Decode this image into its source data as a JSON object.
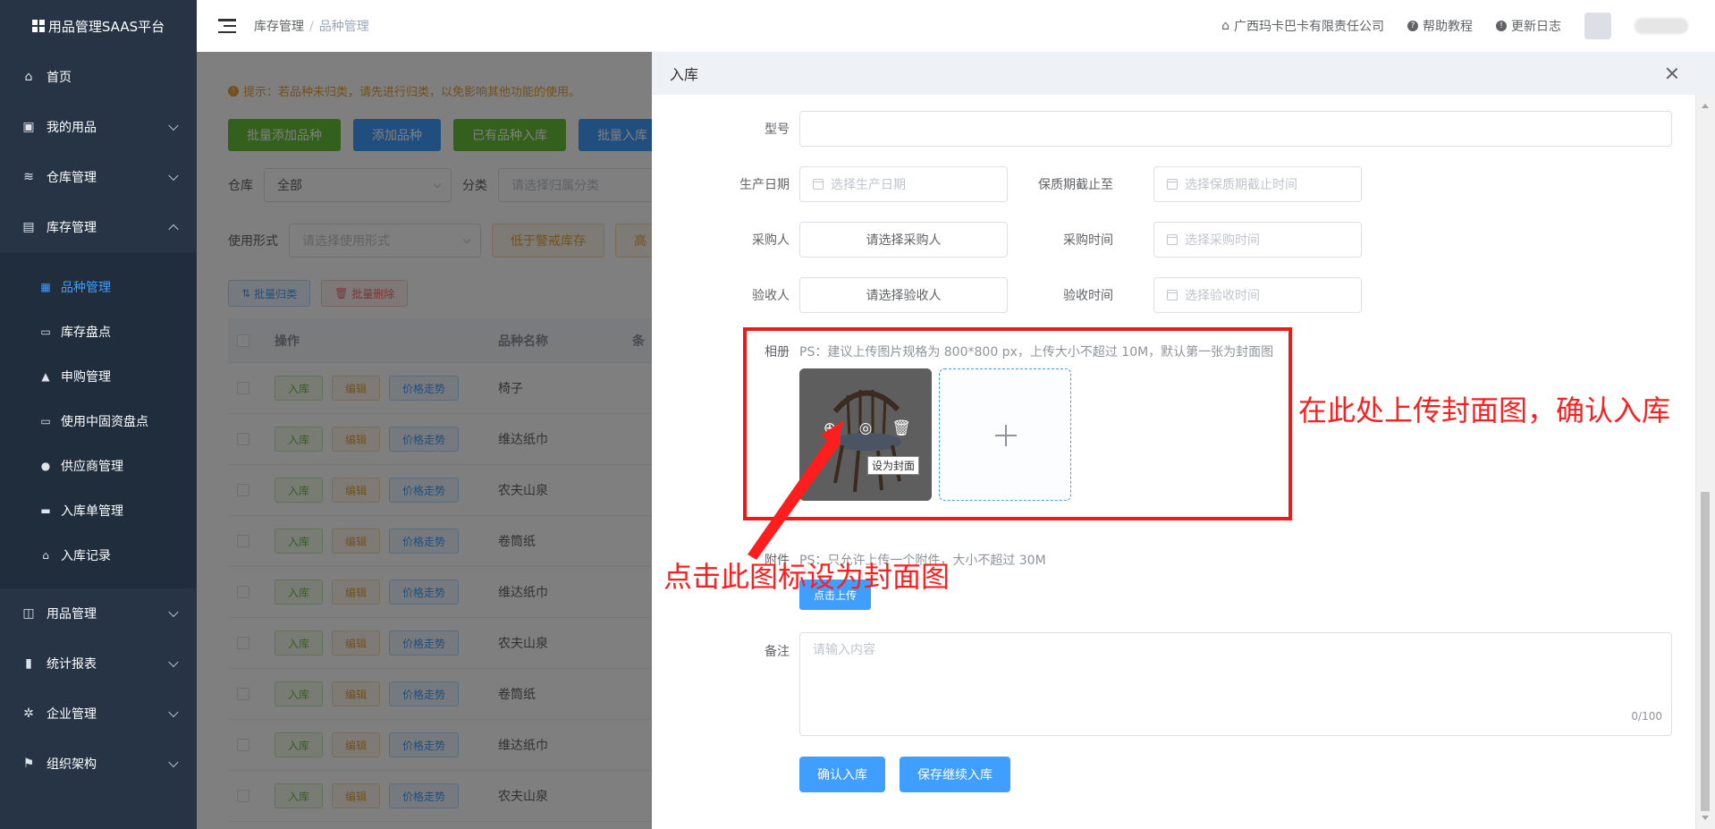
{
  "app": {
    "title": "用品管理SAAS平台"
  },
  "sidebar": {
    "items": [
      {
        "label": "首页",
        "icon": "home-icon"
      },
      {
        "label": "我的用品",
        "icon": "bag-icon"
      },
      {
        "label": "仓库管理",
        "icon": "database-icon"
      },
      {
        "label": "库存管理",
        "icon": "box-icon"
      }
    ],
    "sub_items": [
      {
        "label": "品种管理",
        "icon": "grid-icon",
        "active": true
      },
      {
        "label": "库存盘点",
        "icon": "doc-icon"
      },
      {
        "label": "申购管理",
        "icon": "lock-icon"
      },
      {
        "label": "使用中固资盘点",
        "icon": "doc-icon"
      },
      {
        "label": "供应商管理",
        "icon": "user-icon"
      },
      {
        "label": "入库单管理",
        "icon": "printer-icon"
      },
      {
        "label": "入库记录",
        "icon": "home-icon"
      }
    ],
    "items_bottom": [
      {
        "label": "用品管理",
        "icon": "inbox-icon"
      },
      {
        "label": "统计报表",
        "icon": "bar-chart-icon"
      },
      {
        "label": "企业管理",
        "icon": "gear-icon"
      },
      {
        "label": "组织架构",
        "icon": "flag-icon"
      }
    ]
  },
  "header": {
    "breadcrumb": [
      "库存管理",
      "品种管理"
    ],
    "company": "广西玛卡巴卡有限责任公司",
    "help": "帮助教程",
    "changelog": "更新日志"
  },
  "main": {
    "tip": "提示：若品种未归类，请先进行归类，以免影响其他功能的使用。",
    "toolbar": [
      "批量添加品种",
      "添加品种",
      "已有品种入库",
      "批量入库"
    ],
    "filter_warehouse_label": "仓库",
    "filter_warehouse_value": "全部",
    "filter_category_label": "分类",
    "filter_category_placeholder": "请选择归属分类",
    "filter_usage_label": "使用形式",
    "filter_usage_placeholder": "请选择使用形式",
    "btn_low_stock": "低于警戒库存",
    "btn_high": "高",
    "bulk_classify": "批量归类",
    "bulk_delete": "批量删除",
    "table_headers": [
      "操作",
      "品种名称",
      "条"
    ],
    "row_actions": [
      "入库",
      "编辑",
      "价格走势"
    ],
    "rows": [
      "椅子",
      "维达纸巾",
      "农夫山泉",
      "卷筒纸",
      "维达纸巾",
      "农夫山泉",
      "卷筒纸",
      "维达纸巾",
      "农夫山泉"
    ]
  },
  "drawer": {
    "title": "入库",
    "model_label": "型号",
    "production_date_label": "生产日期",
    "production_date_placeholder": "选择生产日期",
    "expiry_label": "保质期截止至",
    "expiry_placeholder": "选择保质期截止时间",
    "buyer_label": "采购人",
    "buyer_value": "请选择采购人",
    "purchase_time_label": "采购时间",
    "purchase_time_placeholder": "选择采购时间",
    "checker_label": "验收人",
    "checker_value": "请选择验收人",
    "check_time_label": "验收时间",
    "check_time_placeholder": "选择验收时间",
    "album_label": "相册",
    "album_hint": "PS：建议上传图片规格为 800*800 px，上传大小不超过 10M，默认第一张为封面图",
    "set_cover_tooltip": "设为封面",
    "attachment_label": "附件",
    "attachment_hint": "PS：只允许上传一个附件，大小不超过 30M",
    "upload_button": "点击上传",
    "remark_label": "备注",
    "remark_placeholder": "请输入内容",
    "remark_counter": "0/100",
    "confirm_button": "确认入库",
    "save_continue_button": "保存继续入库"
  },
  "annotations": {
    "upload_note": "在此处上传封面图，确认入库",
    "click_note": "点击此图标设为封面图",
    "color": "#ff1e1e"
  }
}
